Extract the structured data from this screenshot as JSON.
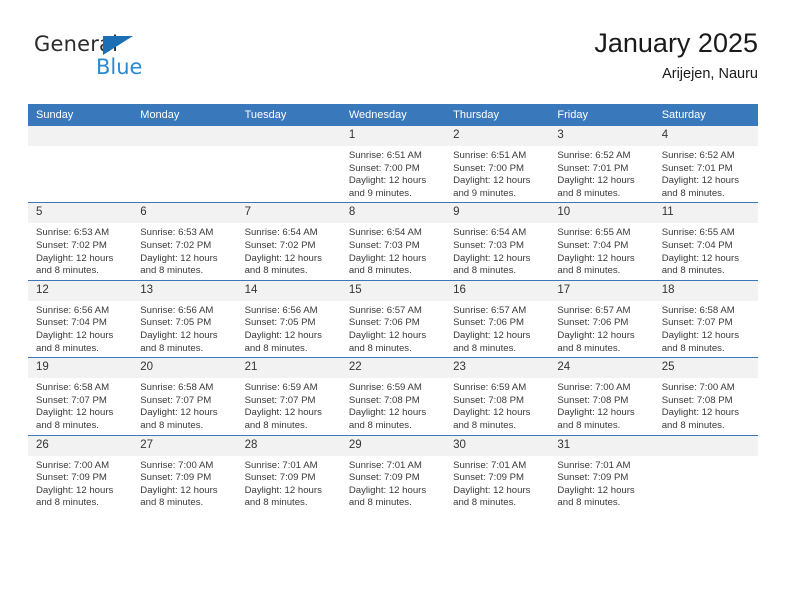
{
  "brand": {
    "name_top": "General",
    "name_bottom": "Blue"
  },
  "header": {
    "title": "January 2025",
    "subtitle": "Arijejen, Nauru"
  },
  "colors": {
    "header_blue": "#3a78bc",
    "brand_blue": "#2a8ad4",
    "daynum_band": "#f2f2f2"
  },
  "calendar": {
    "weekdays": [
      "Sunday",
      "Monday",
      "Tuesday",
      "Wednesday",
      "Thursday",
      "Friday",
      "Saturday"
    ],
    "weeks": [
      [
        {
          "day": "",
          "lines": []
        },
        {
          "day": "",
          "lines": []
        },
        {
          "day": "",
          "lines": []
        },
        {
          "day": "1",
          "lines": [
            "Sunrise: 6:51 AM",
            "Sunset: 7:00 PM",
            "Daylight: 12 hours and 9 minutes."
          ]
        },
        {
          "day": "2",
          "lines": [
            "Sunrise: 6:51 AM",
            "Sunset: 7:00 PM",
            "Daylight: 12 hours and 9 minutes."
          ]
        },
        {
          "day": "3",
          "lines": [
            "Sunrise: 6:52 AM",
            "Sunset: 7:01 PM",
            "Daylight: 12 hours and 8 minutes."
          ]
        },
        {
          "day": "4",
          "lines": [
            "Sunrise: 6:52 AM",
            "Sunset: 7:01 PM",
            "Daylight: 12 hours and 8 minutes."
          ]
        }
      ],
      [
        {
          "day": "5",
          "lines": [
            "Sunrise: 6:53 AM",
            "Sunset: 7:02 PM",
            "Daylight: 12 hours and 8 minutes."
          ]
        },
        {
          "day": "6",
          "lines": [
            "Sunrise: 6:53 AM",
            "Sunset: 7:02 PM",
            "Daylight: 12 hours and 8 minutes."
          ]
        },
        {
          "day": "7",
          "lines": [
            "Sunrise: 6:54 AM",
            "Sunset: 7:02 PM",
            "Daylight: 12 hours and 8 minutes."
          ]
        },
        {
          "day": "8",
          "lines": [
            "Sunrise: 6:54 AM",
            "Sunset: 7:03 PM",
            "Daylight: 12 hours and 8 minutes."
          ]
        },
        {
          "day": "9",
          "lines": [
            "Sunrise: 6:54 AM",
            "Sunset: 7:03 PM",
            "Daylight: 12 hours and 8 minutes."
          ]
        },
        {
          "day": "10",
          "lines": [
            "Sunrise: 6:55 AM",
            "Sunset: 7:04 PM",
            "Daylight: 12 hours and 8 minutes."
          ]
        },
        {
          "day": "11",
          "lines": [
            "Sunrise: 6:55 AM",
            "Sunset: 7:04 PM",
            "Daylight: 12 hours and 8 minutes."
          ]
        }
      ],
      [
        {
          "day": "12",
          "lines": [
            "Sunrise: 6:56 AM",
            "Sunset: 7:04 PM",
            "Daylight: 12 hours and 8 minutes."
          ]
        },
        {
          "day": "13",
          "lines": [
            "Sunrise: 6:56 AM",
            "Sunset: 7:05 PM",
            "Daylight: 12 hours and 8 minutes."
          ]
        },
        {
          "day": "14",
          "lines": [
            "Sunrise: 6:56 AM",
            "Sunset: 7:05 PM",
            "Daylight: 12 hours and 8 minutes."
          ]
        },
        {
          "day": "15",
          "lines": [
            "Sunrise: 6:57 AM",
            "Sunset: 7:06 PM",
            "Daylight: 12 hours and 8 minutes."
          ]
        },
        {
          "day": "16",
          "lines": [
            "Sunrise: 6:57 AM",
            "Sunset: 7:06 PM",
            "Daylight: 12 hours and 8 minutes."
          ]
        },
        {
          "day": "17",
          "lines": [
            "Sunrise: 6:57 AM",
            "Sunset: 7:06 PM",
            "Daylight: 12 hours and 8 minutes."
          ]
        },
        {
          "day": "18",
          "lines": [
            "Sunrise: 6:58 AM",
            "Sunset: 7:07 PM",
            "Daylight: 12 hours and 8 minutes."
          ]
        }
      ],
      [
        {
          "day": "19",
          "lines": [
            "Sunrise: 6:58 AM",
            "Sunset: 7:07 PM",
            "Daylight: 12 hours and 8 minutes."
          ]
        },
        {
          "day": "20",
          "lines": [
            "Sunrise: 6:58 AM",
            "Sunset: 7:07 PM",
            "Daylight: 12 hours and 8 minutes."
          ]
        },
        {
          "day": "21",
          "lines": [
            "Sunrise: 6:59 AM",
            "Sunset: 7:07 PM",
            "Daylight: 12 hours and 8 minutes."
          ]
        },
        {
          "day": "22",
          "lines": [
            "Sunrise: 6:59 AM",
            "Sunset: 7:08 PM",
            "Daylight: 12 hours and 8 minutes."
          ]
        },
        {
          "day": "23",
          "lines": [
            "Sunrise: 6:59 AM",
            "Sunset: 7:08 PM",
            "Daylight: 12 hours and 8 minutes."
          ]
        },
        {
          "day": "24",
          "lines": [
            "Sunrise: 7:00 AM",
            "Sunset: 7:08 PM",
            "Daylight: 12 hours and 8 minutes."
          ]
        },
        {
          "day": "25",
          "lines": [
            "Sunrise: 7:00 AM",
            "Sunset: 7:08 PM",
            "Daylight: 12 hours and 8 minutes."
          ]
        }
      ],
      [
        {
          "day": "26",
          "lines": [
            "Sunrise: 7:00 AM",
            "Sunset: 7:09 PM",
            "Daylight: 12 hours and 8 minutes."
          ]
        },
        {
          "day": "27",
          "lines": [
            "Sunrise: 7:00 AM",
            "Sunset: 7:09 PM",
            "Daylight: 12 hours and 8 minutes."
          ]
        },
        {
          "day": "28",
          "lines": [
            "Sunrise: 7:01 AM",
            "Sunset: 7:09 PM",
            "Daylight: 12 hours and 8 minutes."
          ]
        },
        {
          "day": "29",
          "lines": [
            "Sunrise: 7:01 AM",
            "Sunset: 7:09 PM",
            "Daylight: 12 hours and 8 minutes."
          ]
        },
        {
          "day": "30",
          "lines": [
            "Sunrise: 7:01 AM",
            "Sunset: 7:09 PM",
            "Daylight: 12 hours and 8 minutes."
          ]
        },
        {
          "day": "31",
          "lines": [
            "Sunrise: 7:01 AM",
            "Sunset: 7:09 PM",
            "Daylight: 12 hours and 8 minutes."
          ]
        },
        {
          "day": "",
          "lines": []
        }
      ]
    ]
  }
}
